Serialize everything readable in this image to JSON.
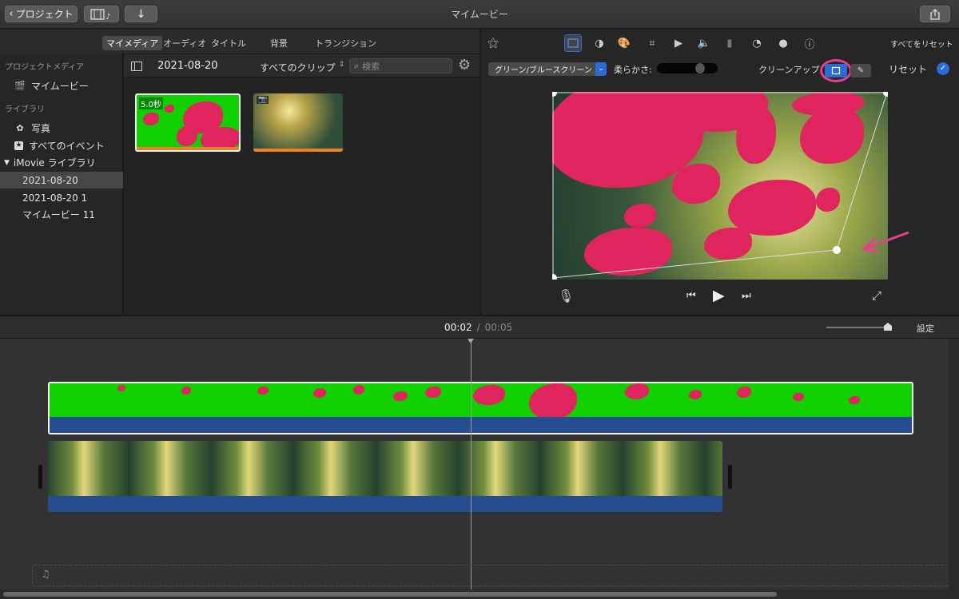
{
  "window": {
    "title": "マイムービー"
  },
  "topbar": {
    "back_label": "プロジェクト",
    "media_icon": "film-music-icon",
    "import_icon": "download-arrow-icon",
    "share_icon": "share-icon"
  },
  "sidebar": {
    "project_media_header": "プロジェクトメディア",
    "project_item": "マイムービー",
    "library_header": "ライブラリ",
    "photos": "写真",
    "all_events": "すべてのイベント",
    "library_name": "iMovie ライブラリ",
    "events": [
      "2021-08-20",
      "2021-08-20 1",
      "マイムービー 11"
    ]
  },
  "media_tabs": [
    "マイメディア",
    "オーディオ",
    "タイトル",
    "背景",
    "トランジション"
  ],
  "browser": {
    "event_title": "2021-08-20",
    "filter_label": "すべてのクリップ",
    "search_placeholder": "検索",
    "clip1_badge": "5.0秒"
  },
  "viewer": {
    "reset_all": "すべてをリセット",
    "effect_select": "グリーン/ブルースクリーン",
    "softness_label": "柔らかさ:",
    "cleanup_label": "クリーンアップ:",
    "reset_label": "リセット",
    "softness_value": 0.85
  },
  "timeline": {
    "current_time": "00:02",
    "separator": "/",
    "total_time": "00:05",
    "settings_label": "設定"
  },
  "colors": {
    "accent": "#2a6bd6",
    "highlight": "#e83e8c",
    "green_screen": "#10d000",
    "audio_bar": "#264d8f"
  }
}
